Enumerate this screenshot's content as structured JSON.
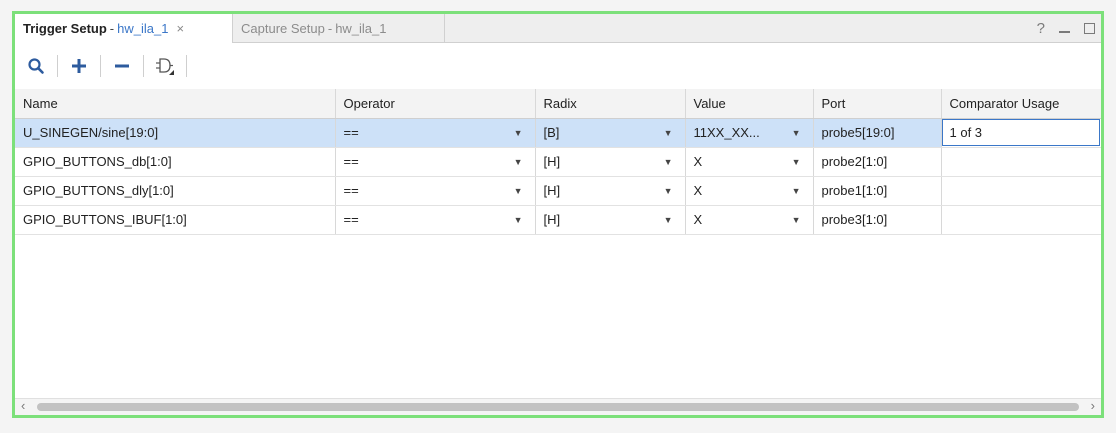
{
  "tabs": [
    {
      "title": "Trigger Setup",
      "sep": "-",
      "target": "hw_ila_1",
      "close": "×"
    },
    {
      "title": "Capture Setup",
      "sep": "-",
      "target": "hw_ila_1"
    }
  ],
  "window_controls": {
    "help": "?"
  },
  "toolbar": {
    "items": [
      "search-icon",
      "plus-icon",
      "minus-icon",
      "trigger-condition-icon"
    ]
  },
  "table": {
    "columns": [
      "Name",
      "Operator",
      "Radix",
      "Value",
      "Port",
      "Comparator Usage"
    ],
    "rows": [
      {
        "name": "U_SINEGEN/sine[19:0]",
        "operator": "==",
        "radix": "[B]",
        "value": "11XX_XX...",
        "port": "probe5[19:0]",
        "usage": "1 of 3"
      },
      {
        "name": "GPIO_BUTTONS_db[1:0]",
        "operator": "==",
        "radix": "[H]",
        "value": "X",
        "port": "probe2[1:0]",
        "usage": ""
      },
      {
        "name": "GPIO_BUTTONS_dly[1:0]",
        "operator": "==",
        "radix": "[H]",
        "value": "X",
        "port": "probe1[1:0]",
        "usage": ""
      },
      {
        "name": "GPIO_BUTTONS_IBUF[1:0]",
        "operator": "==",
        "radix": "[H]",
        "value": "X",
        "port": "probe3[1:0]",
        "usage": ""
      }
    ]
  },
  "scrollbar": {
    "left": "‹",
    "right": "›"
  },
  "colors": {
    "accent": "#3b77c8",
    "frame": "#7ce07a",
    "selection": "#cde1f8"
  }
}
